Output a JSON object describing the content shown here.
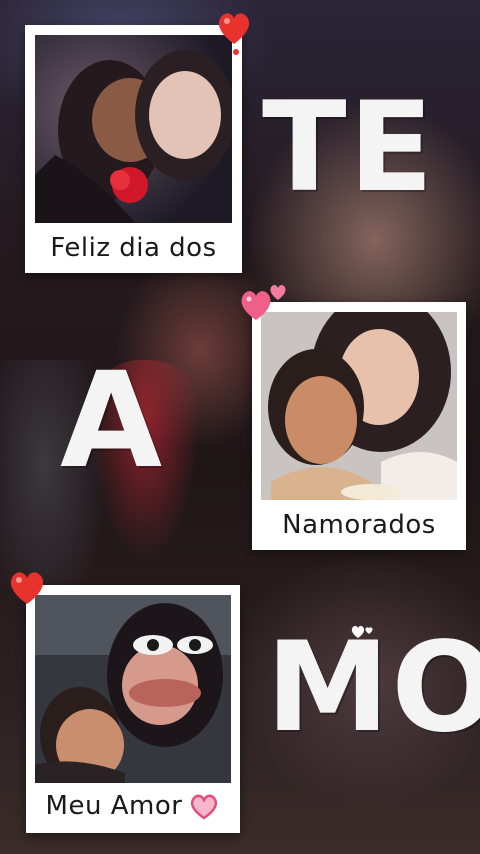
{
  "frames": {
    "top": {
      "caption": "Feliz dia dos"
    },
    "middle": {
      "caption": "Namorados"
    },
    "bottom": {
      "caption": "Meu Amor"
    }
  },
  "headline": {
    "word1": "TE",
    "word2": "A",
    "word3": "MO"
  },
  "icons": {
    "top_heart": "red-heart-icon",
    "middle_hearts": "pink-double-heart-icon",
    "bottom_heart": "red-heart-icon",
    "caption_heart": "pink-outline-heart-icon",
    "mo_hearts": "small-white-hearts-icon"
  },
  "colors": {
    "frame": "#ffffff",
    "letters": "#f4f4f4",
    "heart_red": "#e8322e",
    "heart_pink": "#ef5f8a"
  }
}
